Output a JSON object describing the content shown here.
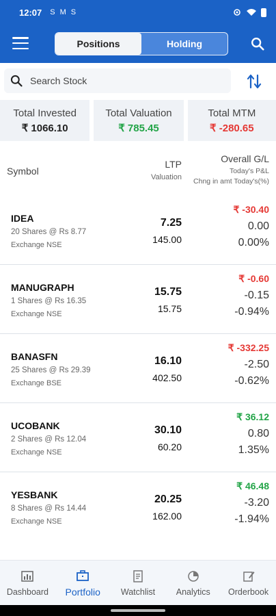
{
  "status_bar": {
    "time": "12:07",
    "icons": [
      "S",
      "M",
      "S"
    ]
  },
  "app_bar": {
    "tabs": [
      {
        "label": "Positions",
        "active": true
      },
      {
        "label": "Holding",
        "active": false
      }
    ],
    "brand_color": "#1b62c6"
  },
  "search": {
    "placeholder": "Search Stock"
  },
  "summary": {
    "invested_label": "Total Invested",
    "invested_value": "₹ 1066.10",
    "valuation_label": "Total Valuation",
    "valuation_value": "₹ 785.45",
    "mtm_label": "Total MTM",
    "mtm_value": "₹ -280.65"
  },
  "columns": {
    "symbol": "Symbol",
    "ltp": "LTP",
    "valuation": "Valuation",
    "overall": "Overall G/L",
    "today_pnl": "Today's P&L",
    "chng": "Chng in amt Today's(%)"
  },
  "rows": [
    {
      "name": "IDEA",
      "qty": "20 Shares @ Rs 8.77",
      "exchange": "Exchange NSE",
      "ltp": "7.25",
      "valuation": "145.00",
      "gl": "₹ -30.40",
      "gl_sign": "neg",
      "pnl": "0.00",
      "pct": "0.00%"
    },
    {
      "name": "MANUGRAPH",
      "qty": "1 Shares @ Rs 16.35",
      "exchange": "Exchange NSE",
      "ltp": "15.75",
      "valuation": "15.75",
      "gl": "₹ -0.60",
      "gl_sign": "neg",
      "pnl": "-0.15",
      "pct": "-0.94%"
    },
    {
      "name": "BANASFN",
      "qty": "25 Shares @ Rs 29.39",
      "exchange": "Exchange BSE",
      "ltp": "16.10",
      "valuation": "402.50",
      "gl": "₹ -332.25",
      "gl_sign": "neg",
      "pnl": "-2.50",
      "pct": "-0.62%"
    },
    {
      "name": "UCOBANK",
      "qty": "2 Shares @ Rs 12.04",
      "exchange": "Exchange NSE",
      "ltp": "30.10",
      "valuation": "60.20",
      "gl": "₹ 36.12",
      "gl_sign": "pos",
      "pnl": "0.80",
      "pct": "1.35%"
    },
    {
      "name": "YESBANK",
      "qty": "8 Shares @ Rs 14.44",
      "exchange": "Exchange NSE",
      "ltp": "20.25",
      "valuation": "162.00",
      "gl": "₹ 46.48",
      "gl_sign": "pos",
      "pnl": "-3.20",
      "pct": "-1.94%"
    }
  ],
  "nav": [
    {
      "label": "Dashboard",
      "icon": "chart-icon"
    },
    {
      "label": "Portfolio",
      "icon": "briefcase-icon",
      "active": true
    },
    {
      "label": "Watchlist",
      "icon": "document-icon"
    },
    {
      "label": "Analytics",
      "icon": "pie-icon"
    },
    {
      "label": "Orderbook",
      "icon": "edit-icon"
    }
  ],
  "colors": {
    "negative": "#e53935",
    "positive": "#22a447"
  }
}
